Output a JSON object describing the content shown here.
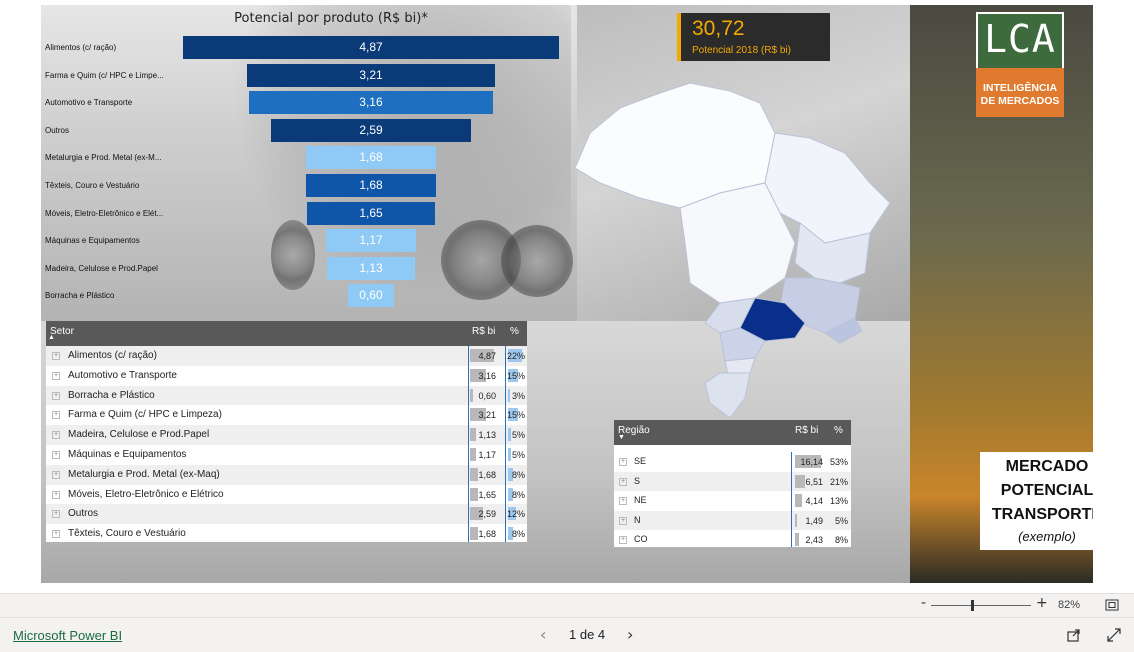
{
  "colors": {
    "bar_dark": "#0b3a78",
    "bar_mid": "#1f6fc0",
    "bar_light": "#8fcaf6",
    "map_highlight": "#0a2f8a",
    "kpi_accent": "#f2a900",
    "logo_green": "#3d6b3e",
    "logo_orange": "#e07a2e",
    "powerbi_link": "#1b6c3e"
  },
  "chart_data": {
    "type": "bar",
    "title": "Potencial por produto (R$ bi)*",
    "orientation": "horizontal",
    "categories": [
      "Alimentos (c/ ração)",
      "Farma e Quim (c/ HPC e Limpe...",
      "Automotivo e Transporte",
      "Outros",
      "Metalurgia e Prod. Metal (ex-M...",
      "Têxteis, Couro e Vestuário",
      "Móveis, Eletro-Eletrônico e Elét...",
      "Máquinas e Equipamentos",
      "Madeira, Celulose e Prod.Papel",
      "Borracha e Plástico"
    ],
    "values": [
      4.87,
      3.21,
      3.16,
      2.59,
      1.68,
      1.68,
      1.65,
      1.17,
      1.13,
      0.6
    ],
    "value_labels": [
      "4,87",
      "3,21",
      "3,16",
      "2,59",
      "1,68",
      "1,68",
      "1,65",
      "1,17",
      "1,13",
      "0,60"
    ],
    "bar_colors": [
      "#0b3a78",
      "#0b3a78",
      "#1f6fc0",
      "#0b3a78",
      "#8fcaf6",
      "#0f55a8",
      "#0f55a8",
      "#8fcaf6",
      "#8fcaf6",
      "#8fcaf6"
    ],
    "xlim": [
      0,
      4.87
    ]
  },
  "setor_table": {
    "headers": {
      "setor": "Setor",
      "rs_bi": "R$ bi",
      "pct": "%"
    },
    "rows": [
      {
        "name": "Alimentos (c/ ração)",
        "value": "4,87",
        "pct": "22%",
        "value_num": 4.87,
        "pct_num": 22
      },
      {
        "name": "Automotivo e Transporte",
        "value": "3,16",
        "pct": "15%",
        "value_num": 3.16,
        "pct_num": 15
      },
      {
        "name": "Borracha e Plástico",
        "value": "0,60",
        "pct": "3%",
        "value_num": 0.6,
        "pct_num": 3
      },
      {
        "name": "Farma e Quim (c/ HPC e Limpeza)",
        "value": "3,21",
        "pct": "15%",
        "value_num": 3.21,
        "pct_num": 15
      },
      {
        "name": "Madeira, Celulose e Prod.Papel",
        "value": "1,13",
        "pct": "5%",
        "value_num": 1.13,
        "pct_num": 5
      },
      {
        "name": "Máquinas e Equipamentos",
        "value": "1,17",
        "pct": "5%",
        "value_num": 1.17,
        "pct_num": 5
      },
      {
        "name": "Metalurgia e Prod. Metal (ex-Maq)",
        "value": "1,68",
        "pct": "8%",
        "value_num": 1.68,
        "pct_num": 8
      },
      {
        "name": "Móveis, Eletro-Eletrônico e Elétrico",
        "value": "1,65",
        "pct": "8%",
        "value_num": 1.65,
        "pct_num": 8
      },
      {
        "name": "Outros",
        "value": "2,59",
        "pct": "12%",
        "value_num": 2.59,
        "pct_num": 12
      },
      {
        "name": "Têxteis, Couro e Vestuário",
        "value": "1,68",
        "pct": "8%",
        "value_num": 1.68,
        "pct_num": 8
      }
    ]
  },
  "regiao_table": {
    "headers": {
      "regiao": "Região",
      "rs_bi": "R$ bi",
      "pct": "%"
    },
    "rows": [
      {
        "name": "SE",
        "value": "16,14",
        "pct": "53%",
        "value_num": 16.14
      },
      {
        "name": "S",
        "value": "6,51",
        "pct": "21%",
        "value_num": 6.51
      },
      {
        "name": "NE",
        "value": "4,14",
        "pct": "13%",
        "value_num": 4.14
      },
      {
        "name": "N",
        "value": "1,49",
        "pct": "5%",
        "value_num": 1.49
      },
      {
        "name": "CO",
        "value": "2,43",
        "pct": "8%",
        "value_num": 2.43
      }
    ]
  },
  "kpi": {
    "value": "30,72",
    "label": "Potencial 2018 (R$ bi)"
  },
  "logo": {
    "letters": "LCA",
    "line1": "INTELIGÊNCIA",
    "line2": "DE MERCADOS"
  },
  "mercado_box": {
    "line1": "MERCADO",
    "line2": "POTENCIAL",
    "line3": "TRANSPORTE",
    "sub": "(exemplo)"
  },
  "zoom": {
    "minus": "-",
    "plus": "+",
    "level": "82%",
    "slider_fraction": 0.4
  },
  "footer": {
    "powerbi": "Microsoft Power BI",
    "page": "1 de 4",
    "prev": "‹",
    "next": "›"
  },
  "icons": {
    "fit_page": "fit-page-icon",
    "share": "share-icon",
    "fullscreen": "fullscreen-icon",
    "map": "brazil-map"
  }
}
